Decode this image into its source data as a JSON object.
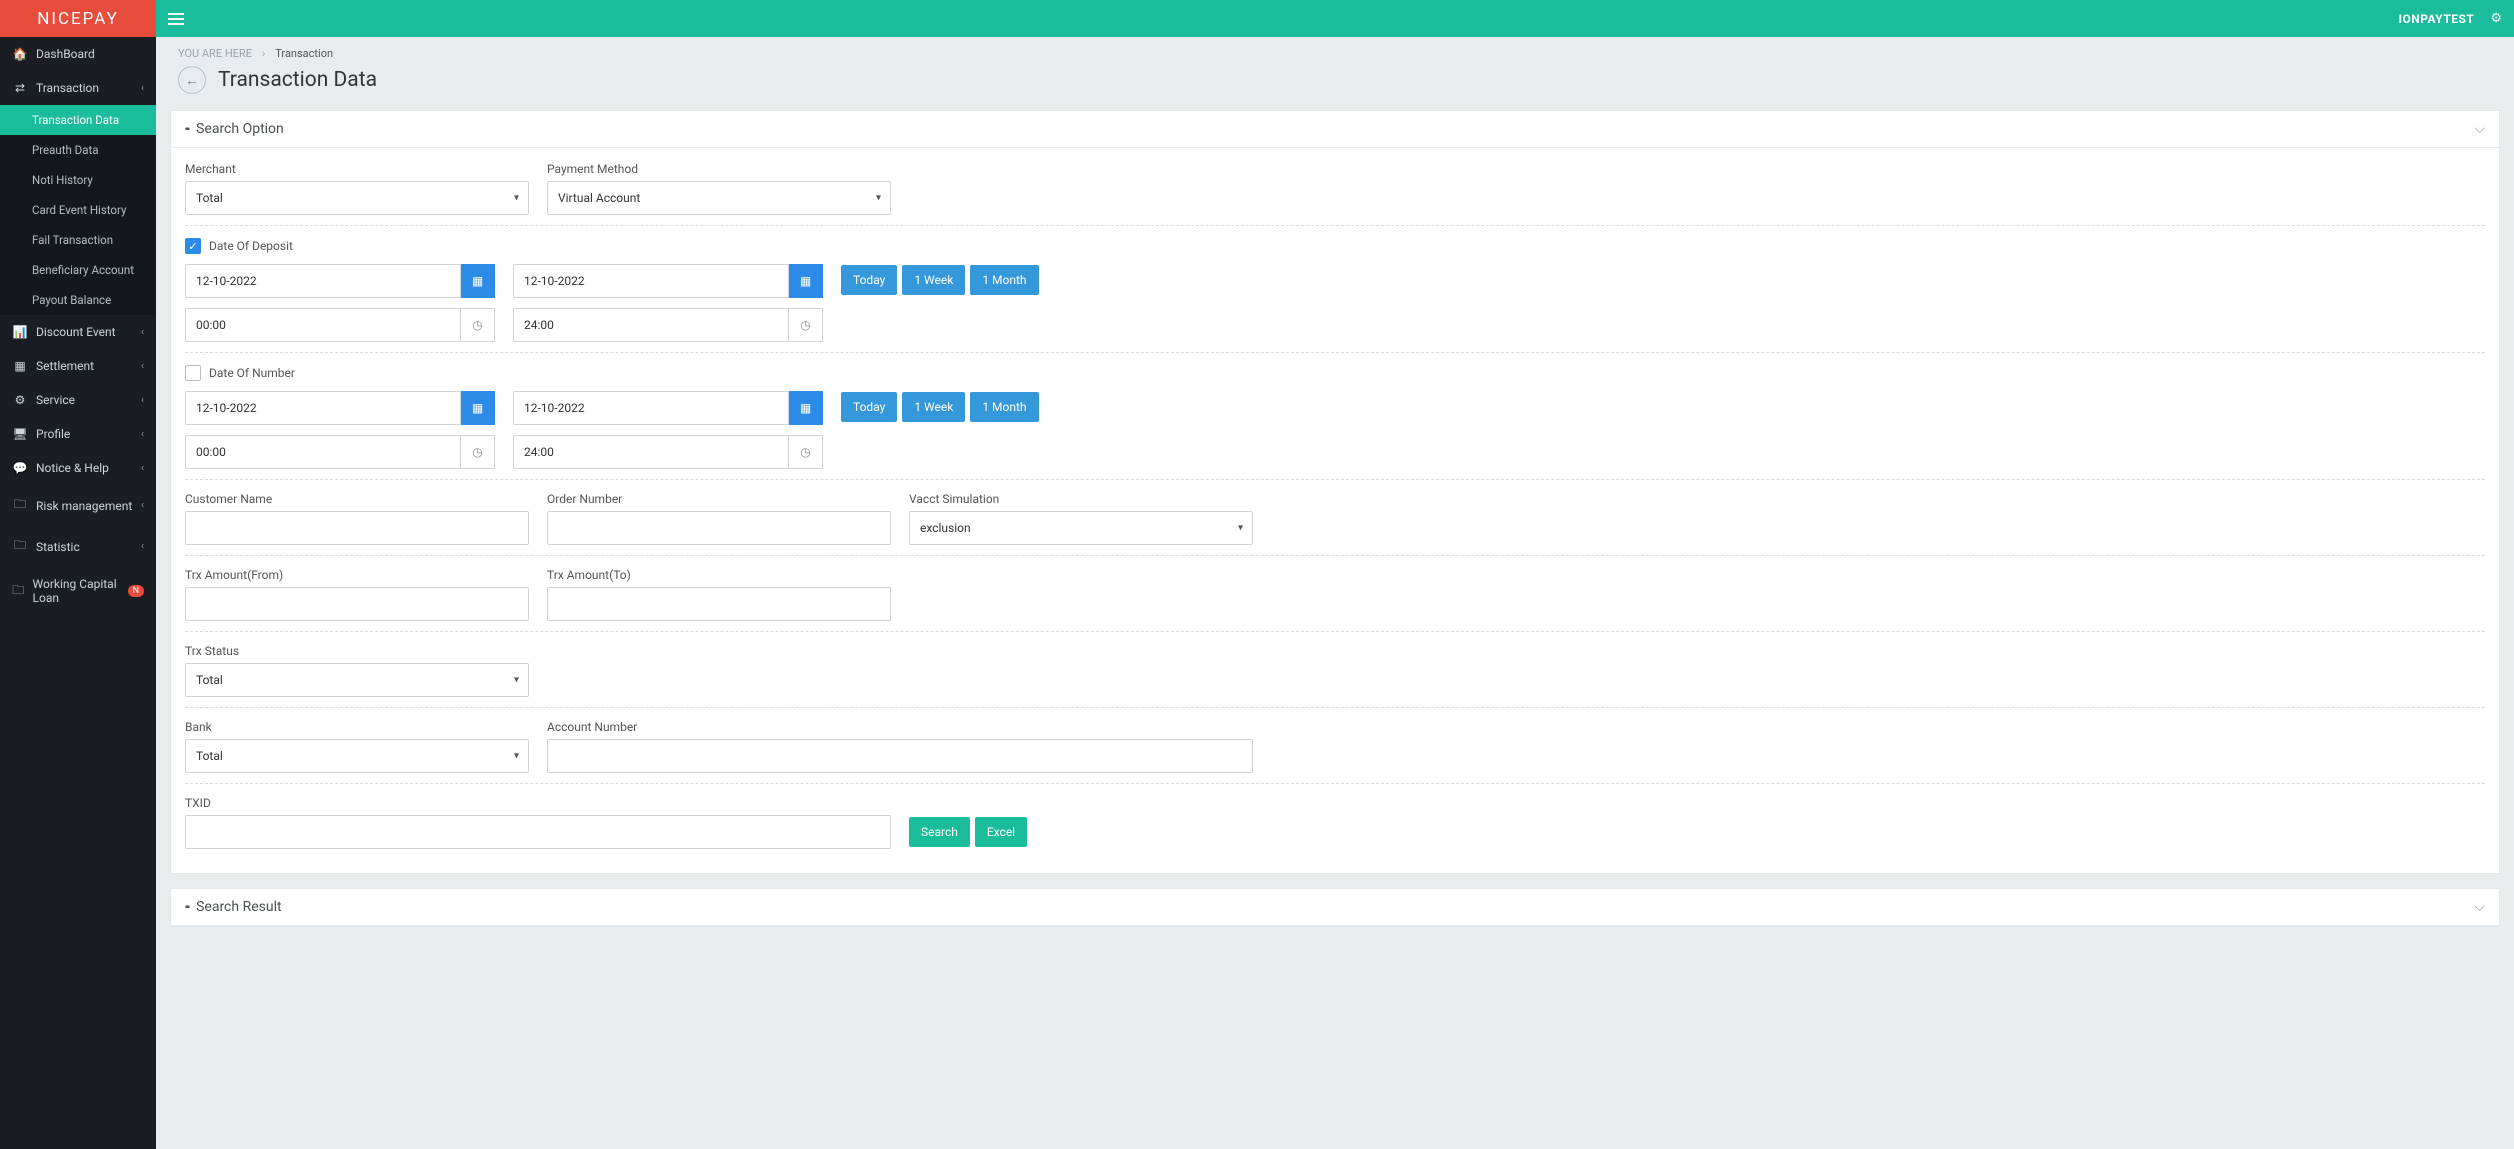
{
  "brand": "NICEPAY",
  "user": "IONPAYTEST",
  "breadcrumb": {
    "label": "YOU ARE HERE",
    "sep": "›",
    "current": "Transaction"
  },
  "pageTitle": "Transaction Data",
  "sidebar": {
    "items": [
      {
        "label": "DashBoard",
        "icon": "dashboard-icon"
      },
      {
        "label": "Transaction",
        "icon": "exchange-icon",
        "expanded": true
      },
      {
        "label": "Discount Event",
        "icon": "chart-icon"
      },
      {
        "label": "Settlement",
        "icon": "calendar-icon"
      },
      {
        "label": "Service",
        "icon": "gear-icon"
      },
      {
        "label": "Profile",
        "icon": "monitor-icon"
      },
      {
        "label": "Notice & Help",
        "icon": "chat-icon"
      },
      {
        "label": "Risk management",
        "icon": "folder-icon"
      },
      {
        "label": "Statistic",
        "icon": "folder-icon"
      },
      {
        "label": "Working Capital Loan",
        "icon": "folder-icon",
        "badge": "N"
      }
    ],
    "transactionSub": [
      "Transaction Data",
      "Preauth Data",
      "Noti History",
      "Card Event History",
      "Fail Transaction",
      "Beneficiary Account",
      "Payout Balance"
    ]
  },
  "panels": {
    "searchOption": "Search Option",
    "searchResult": "Search Result"
  },
  "form": {
    "merchant": {
      "label": "Merchant",
      "value": "Total"
    },
    "paymentMethod": {
      "label": "Payment Method",
      "value": "Virtual Account"
    },
    "dateOfDeposit": {
      "label": "Date Of Deposit",
      "checked": true,
      "from": "12-10-2022",
      "to": "12-10-2022",
      "timeFrom": "00:00",
      "timeTo": "24:00"
    },
    "dateOfNumber": {
      "label": "Date Of Number",
      "checked": false,
      "from": "12-10-2022",
      "to": "12-10-2022",
      "timeFrom": "00:00",
      "timeTo": "24:00"
    },
    "quickRange": {
      "today": "Today",
      "week": "1 Week",
      "month": "1 Month"
    },
    "customerName": {
      "label": "Customer Name",
      "value": ""
    },
    "orderNumber": {
      "label": "Order Number",
      "value": ""
    },
    "vacctSimulation": {
      "label": "Vacct Simulation",
      "value": "exclusion"
    },
    "trxAmountFrom": {
      "label": "Trx Amount(From)",
      "value": ""
    },
    "trxAmountTo": {
      "label": "Trx Amount(To)",
      "value": ""
    },
    "trxStatus": {
      "label": "Trx Status",
      "value": "Total"
    },
    "bank": {
      "label": "Bank",
      "value": "Total"
    },
    "accountNumber": {
      "label": "Account Number",
      "value": ""
    },
    "txid": {
      "label": "TXID",
      "value": ""
    },
    "buttons": {
      "search": "Search",
      "excel": "Excel"
    }
  }
}
